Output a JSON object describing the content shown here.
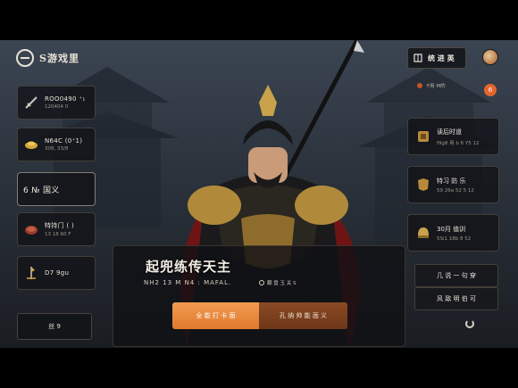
{
  "logo": {
    "text": "S游戏里"
  },
  "top_right": {
    "label": "统 进 英",
    "avatar_icon": "avatar-icon"
  },
  "notification": {
    "text": "F用 M的",
    "count": "6"
  },
  "left_cards": [
    {
      "main": "ROO0490 ⁺₁",
      "sub": "120404 0",
      "icon": "sword-icon"
    },
    {
      "main": "N64C (0⁺1)",
      "sub": "308, 33/8",
      "icon": "gold-ingot-icon"
    },
    {
      "main": "6 № 国义",
      "sub": "",
      "icon": ""
    },
    {
      "main": "特持门 ( )",
      "sub": "13 18 60 F",
      "icon": "meat-icon"
    },
    {
      "main": "D7 9gu",
      "sub": "",
      "icon": "halberd-icon"
    }
  ],
  "bottom_left_button": "丝 9",
  "right_cards": [
    {
      "main": "读后时道",
      "sub": "f9g8 用 b 6 Y5 12",
      "icon": "scroll-icon"
    },
    {
      "main": "特习 防 乐",
      "sub": "59 26a 52 5 12",
      "icon": "armor-icon"
    },
    {
      "main": "30月 值训",
      "sub": "5Si1 18b 8 52",
      "icon": "helmet-icon"
    }
  ],
  "hero": {
    "name": "起兜练传天主",
    "title": "NH2 13 M N4 : MAFAL.",
    "tag": "翻 盘 玉 关 S"
  },
  "buttons": {
    "primary": "全 能 打 卡 面",
    "secondary": "孔 纳 帅 能 面 义"
  },
  "side_buttons": [
    "几 说 一 句 穿",
    "风 敌 明 伯 可"
  ],
  "colors": {
    "accent_orange": "#e9883a",
    "accent_brown": "#7a3f1d",
    "badge_red": "#e2662d"
  }
}
